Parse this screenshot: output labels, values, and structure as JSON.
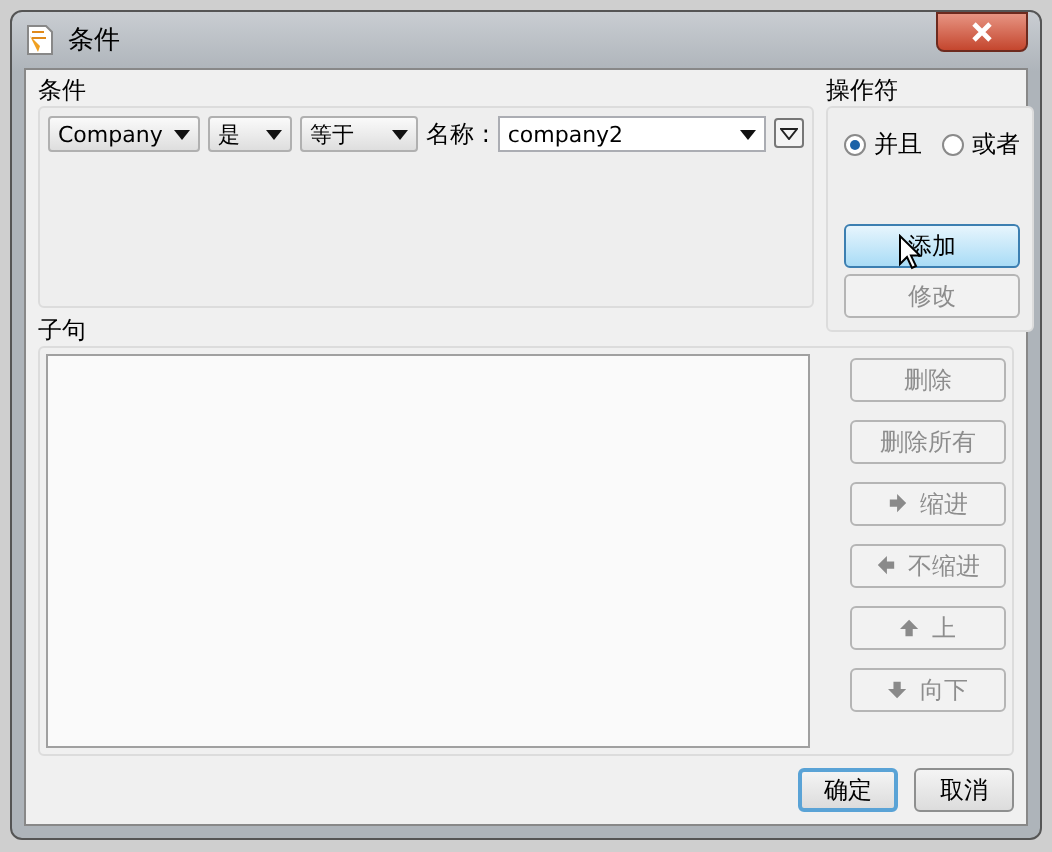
{
  "window": {
    "title": "条件"
  },
  "conditions": {
    "label": "条件",
    "combos": [
      {
        "value": "Company"
      },
      {
        "value": "是"
      },
      {
        "value": "等于"
      }
    ],
    "name_label": "名称 :",
    "name_value": "company2"
  },
  "operator": {
    "label": "操作符",
    "options": [
      {
        "label": "并且",
        "selected": true
      },
      {
        "label": "或者",
        "selected": false
      }
    ],
    "buttons": [
      {
        "label": "添加",
        "disabled": false,
        "highlighted": true
      },
      {
        "label": "修改",
        "disabled": true,
        "highlighted": false
      }
    ]
  },
  "clauses": {
    "label": "子句",
    "buttons": [
      {
        "label": "删除",
        "kind": "plain",
        "disabled": true
      },
      {
        "label": "删除所有",
        "kind": "plain",
        "disabled": true
      },
      {
        "label": "缩进",
        "kind": "indent",
        "disabled": true
      },
      {
        "label": "不缩进",
        "kind": "outdent",
        "disabled": true
      },
      {
        "label": "上",
        "kind": "up",
        "disabled": true
      },
      {
        "label": "向下",
        "kind": "down",
        "disabled": true
      }
    ]
  },
  "footer": {
    "buttons": [
      {
        "label": "确定",
        "default": true
      },
      {
        "label": "取消",
        "default": false
      }
    ]
  }
}
